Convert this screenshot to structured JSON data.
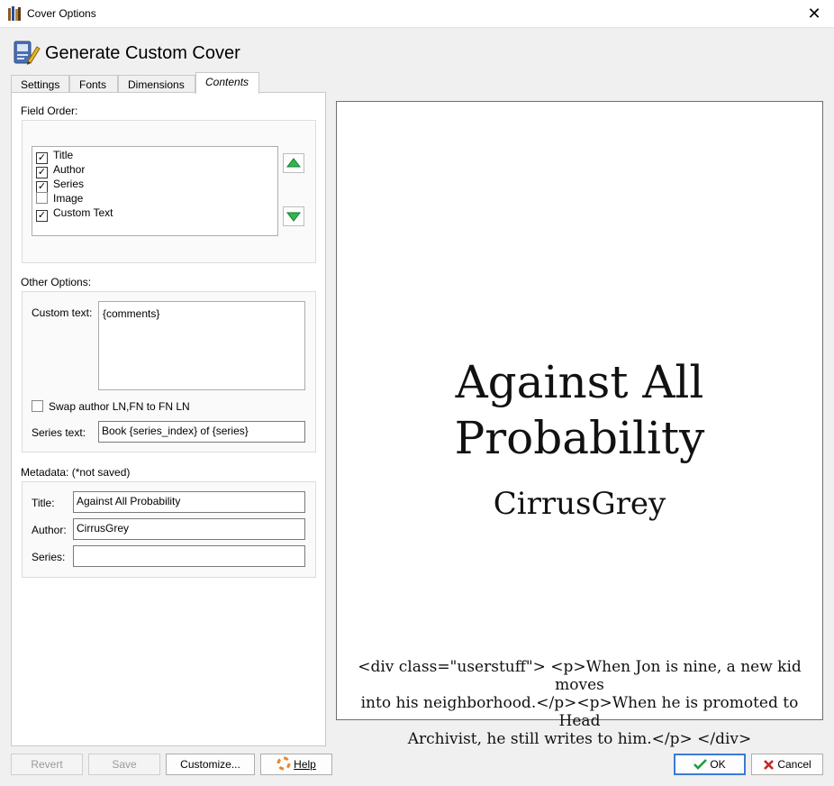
{
  "window": {
    "title": "Cover Options"
  },
  "header": {
    "title": "Generate Custom Cover"
  },
  "tabs": [
    {
      "label": "Settings"
    },
    {
      "label": "Fonts"
    },
    {
      "label": "Dimensions"
    },
    {
      "label": "Contents",
      "active": true
    }
  ],
  "field_order": {
    "label": "Field Order:",
    "items": [
      {
        "label": "Title",
        "checked": true
      },
      {
        "label": "Author",
        "checked": true
      },
      {
        "label": "Series",
        "checked": true
      },
      {
        "label": "Image",
        "checked": false
      },
      {
        "label": "Custom Text",
        "checked": true
      }
    ]
  },
  "other_options": {
    "label": "Other Options:",
    "custom_text_label": "Custom text:",
    "custom_text_value": "{comments}",
    "swap_label": "Swap author LN,FN to FN LN",
    "swap_checked": false,
    "series_text_label": "Series text:",
    "series_text_value": "Book {series_index} of {series}"
  },
  "metadata": {
    "label": "Metadata: (*not saved)",
    "title_label": "Title:",
    "title_value": "Against All Probability",
    "author_label": "Author:",
    "author_value": "CirrusGrey",
    "series_label": "Series:",
    "series_value": ""
  },
  "preview": {
    "title_line1": "Against All",
    "title_line2": "Probability",
    "author": "CirrusGrey",
    "custom_line1": "<div class=\"userstuff\"> <p>When Jon is nine, a new kid moves",
    "custom_line2": "into his neighborhood.</p><p>When he is promoted to Head",
    "custom_line3": "Archivist, he still writes to him.</p> </div>"
  },
  "buttons": {
    "revert": "Revert",
    "save": "Save",
    "customize": "Customize...",
    "help": "Help",
    "ok": "OK",
    "cancel": "Cancel"
  },
  "colors": {
    "arrow_green": "#2eb84f",
    "ok_check": "#1e9e3a",
    "cancel_x": "#cc2222",
    "default_button_border": "#3a7bd5"
  }
}
